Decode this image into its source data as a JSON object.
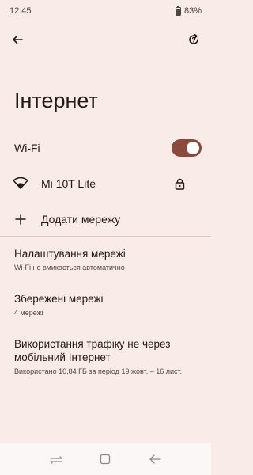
{
  "status": {
    "time": "12:45",
    "battery": "83%"
  },
  "page": {
    "title": "Інтернет"
  },
  "wifi": {
    "label": "Wi-Fi",
    "enabled": true
  },
  "network": {
    "name": "Mi 10T Lite"
  },
  "add_network": {
    "label": "Додати мережу"
  },
  "settings": [
    {
      "title": "Налаштування мережі",
      "subtitle": "Wi-Fi не вмикається автоматично"
    },
    {
      "title": "Збережені мережі",
      "subtitle": "4 мережі"
    },
    {
      "title": "Використання трафіку не через мобільний Інтернет",
      "subtitle": "Використано 10,84 ГБ за період 19 жовт. – 16 лист."
    }
  ],
  "colors": {
    "background": "#f9ebe8",
    "accent": "#8c4a3f",
    "text": "#231917"
  },
  "icons": {
    "back": "arrow-back-icon",
    "help": "help-refresh-icon",
    "wifi": "wifi-icon",
    "lock": "lock-icon",
    "add": "plus-icon"
  }
}
